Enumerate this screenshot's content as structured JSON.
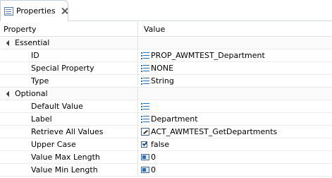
{
  "tab": {
    "title": "Properties",
    "icon": "properties-view-icon",
    "close_icon": "close-icon"
  },
  "columns": {
    "property": "Property",
    "value": "Value"
  },
  "categories": [
    {
      "label": "Essential",
      "rows": [
        {
          "name": "ID",
          "value": "PROP_AWMTEST_Department",
          "icon": "text-value-icon"
        },
        {
          "name": "Special Property",
          "value": "NONE",
          "icon": "text-value-icon"
        },
        {
          "name": "Type",
          "value": "String",
          "icon": "text-value-icon"
        }
      ]
    },
    {
      "label": "Optional",
      "rows": [
        {
          "name": "Default Value",
          "value": "",
          "icon": "text-value-icon"
        },
        {
          "name": "Label",
          "value": "Department",
          "icon": "text-value-icon"
        },
        {
          "name": "Retrieve All Values",
          "value": "ACT_AWMTEST_GetDepartments",
          "icon": "link-reference-icon"
        },
        {
          "name": "Upper Case",
          "value": "false",
          "icon": "boolean-value-icon"
        },
        {
          "name": "Value Max Length",
          "value": "0",
          "icon": "integer-value-icon"
        },
        {
          "name": "Value Min Length",
          "value": "0",
          "icon": "integer-value-icon"
        }
      ]
    }
  ]
}
